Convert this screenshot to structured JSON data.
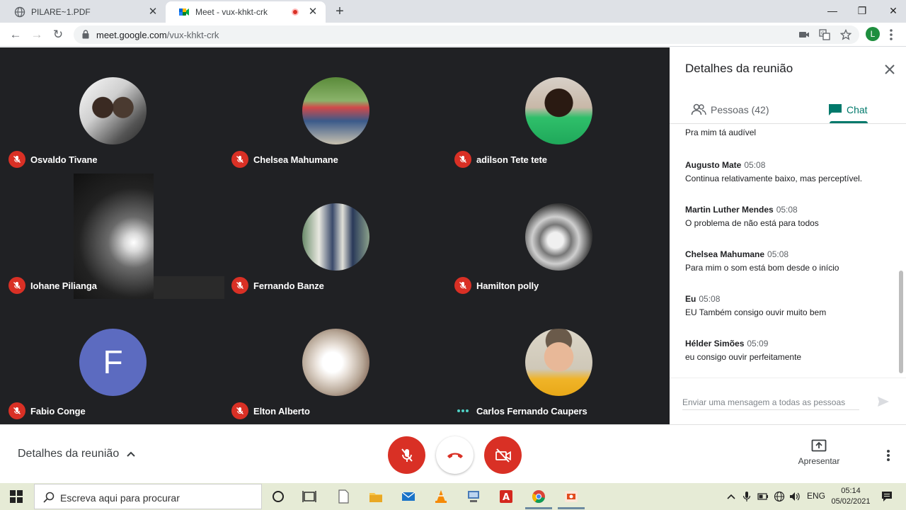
{
  "browser": {
    "tabs": [
      {
        "title": "PILARE~1.PDF",
        "icon": "globe-icon",
        "active": false
      },
      {
        "title": "Meet - vux-khkt-crk",
        "icon": "meet-icon",
        "active": true
      }
    ],
    "url_domain": "meet.google.com",
    "url_path": "/vux-khkt-crk",
    "profile_initial": "L"
  },
  "participants": [
    {
      "name": "Osvaldo Tivane",
      "mic": "muted",
      "avatar": "photo"
    },
    {
      "name": "Chelsea Mahumane",
      "mic": "muted",
      "avatar": "photo"
    },
    {
      "name": "adilson Tete tete",
      "mic": "muted",
      "avatar": "photo"
    },
    {
      "name": "Iohane Pilianga",
      "mic": "muted",
      "avatar": "video"
    },
    {
      "name": "Fernando Banze",
      "mic": "muted",
      "avatar": "photo"
    },
    {
      "name": "Hamilton polly",
      "mic": "muted",
      "avatar": "photo"
    },
    {
      "name": "Fabio Conge",
      "mic": "muted",
      "avatar": "letter",
      "initial": "F"
    },
    {
      "name": "Elton Alberto",
      "mic": "muted",
      "avatar": "photo"
    },
    {
      "name": "Carlos Fernando Caupers",
      "mic": "speaking",
      "avatar": "photo"
    }
  ],
  "panel": {
    "title": "Detalhes da reunião",
    "people_tab": "Pessoas (42)",
    "chat_tab": "Chat",
    "partial_message": "Pra mim tá audível",
    "messages": [
      {
        "sender": "Augusto Mate",
        "time": "05:08",
        "text": "Continua relativamente baixo, mas perceptível."
      },
      {
        "sender": "Martin Luther Mendes",
        "time": "05:08",
        "text": "O problema de não está para todos"
      },
      {
        "sender": "Chelsea Mahumane",
        "time": "05:08",
        "text": "Para mim o som está bom desde o início"
      },
      {
        "sender": "Eu",
        "time": "05:08",
        "text": "EU Também consigo ouvir muito bem"
      },
      {
        "sender": "Hélder Simões",
        "time": "05:09",
        "text": "eu consigo ouvir perfeitamente"
      }
    ],
    "compose_placeholder": "Enviar uma mensagem a todas as pessoas"
  },
  "controls": {
    "meeting_details": "Detalhes da reunião",
    "present_label": "Apresentar"
  },
  "taskbar": {
    "search_placeholder": "Escreva aqui para procurar",
    "language": "ENG",
    "time": "05:14",
    "date": "05/02/2021"
  },
  "colors": {
    "meet_bg": "#202124",
    "danger": "#d93025",
    "accent": "#00796b",
    "avatar_letter_bg": "#5c6bc0"
  }
}
